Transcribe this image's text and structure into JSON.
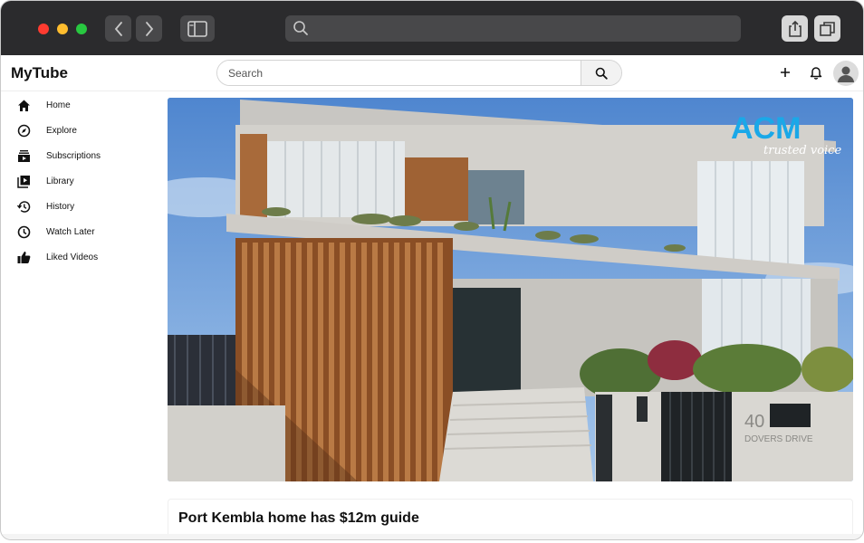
{
  "app": {
    "name": "MyTube"
  },
  "search": {
    "placeholder": "Search"
  },
  "sidebar": {
    "items": [
      {
        "label": "Home",
        "icon": "home-icon"
      },
      {
        "label": "Explore",
        "icon": "compass-icon"
      },
      {
        "label": "Subscriptions",
        "icon": "subscriptions-icon"
      },
      {
        "label": "Library",
        "icon": "library-icon"
      },
      {
        "label": "History",
        "icon": "history-icon"
      },
      {
        "label": "Watch Later",
        "icon": "clock-icon"
      },
      {
        "label": "Liked Videos",
        "icon": "thumbs-up-icon"
      }
    ]
  },
  "video": {
    "title": "Port Kembla home has $12m guide",
    "watermark_brand": "ACM",
    "watermark_tagline": "trusted voice",
    "house_number": "40",
    "street_sign": "DOVERS DRIVE"
  },
  "colors": {
    "chrome": "#2b2b2d",
    "chrome_button": "#48484a",
    "traffic_red": "#ff3b30",
    "traffic_yellow": "#ffbd2e",
    "traffic_green": "#28c840",
    "watermark": "#1aa8e8"
  }
}
